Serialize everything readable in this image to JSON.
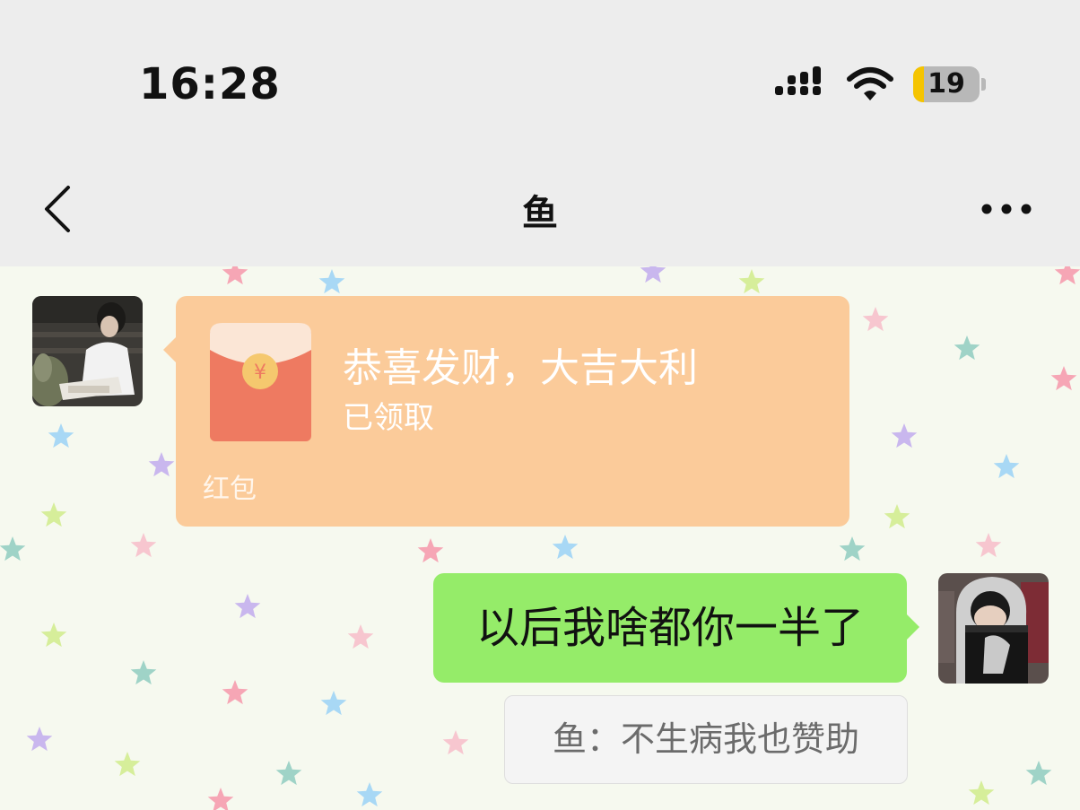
{
  "status_bar": {
    "time": "16:28",
    "battery_level": "19",
    "signal_icon": "cellular-signal-icon",
    "wifi_icon": "wifi-icon",
    "battery_icon": "battery-icon"
  },
  "header": {
    "title": "鱼",
    "back_icon": "chevron-left-icon",
    "more_icon": "ellipsis-icon"
  },
  "messages": [
    {
      "type": "red_packet",
      "sender": "other",
      "greeting": "恭喜发财，大吉大利",
      "status": "已领取",
      "label": "红包"
    },
    {
      "type": "text",
      "sender": "me",
      "text": "以后我啥都你一半了",
      "quote": "鱼：不生病我也赞助"
    }
  ],
  "colors": {
    "red_packet_bg": "#fbcb9a",
    "my_bubble_bg": "#95ec69",
    "header_bg": "#ededed",
    "chat_bg": "#f6f9ef"
  }
}
